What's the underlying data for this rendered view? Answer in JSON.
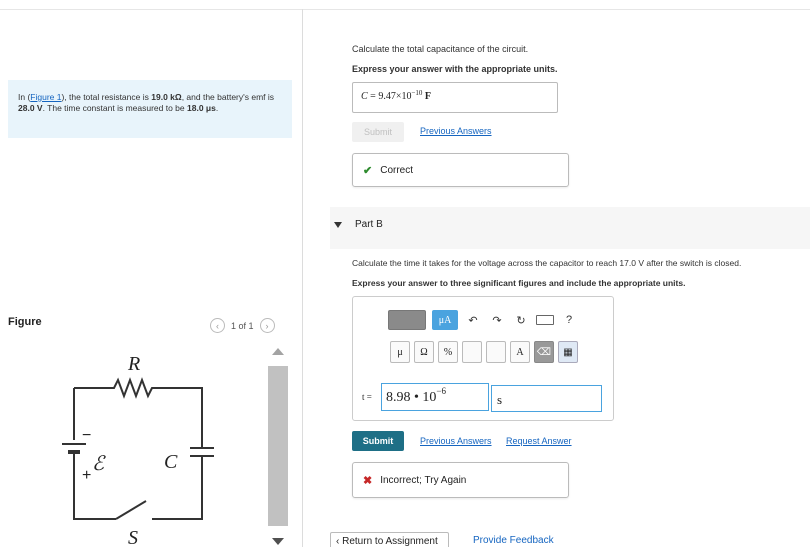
{
  "intro": {
    "prefix": "In (",
    "figure_link": "Figure 1",
    "text1": "), the total resistance is",
    "resistance": "19.0 kΩ",
    "text2": ", and the battery's emf is",
    "emf": "28.0 V",
    "text3": ". The time constant is measured to be",
    "time_constant": "18.0 μs",
    "text4": "."
  },
  "figure": {
    "title": "Figure",
    "pager": "1 of 1",
    "labels": {
      "R": "R",
      "emf": "ℰ",
      "C": "C",
      "S": "S",
      "plus": "+",
      "minus": "−"
    }
  },
  "partA": {
    "question": "Calculate the total capacitance of the circuit.",
    "instruction": "Express your answer with the appropriate units.",
    "answer_var": "C",
    "answer_mantissa": "9.47×10",
    "answer_exp": "−10",
    "answer_unit": "F",
    "submit_label": "Submit",
    "previous_answers": "Previous Answers",
    "feedback": "Correct"
  },
  "partB": {
    "label": "Part B",
    "question": "Calculate the time it takes for the voltage across the capacitor to reach 17.0 V after the switch is closed.",
    "instruction": "Express your answer to three significant figures and include the appropriate units.",
    "toolbar": {
      "mu_btn": "μA",
      "help": "?",
      "mu": "μ",
      "omega": "Ω",
      "percent": "%",
      "angstrom": "A"
    },
    "var_label": "t =",
    "value_mantissa": "8.98 • 10",
    "value_exp": "−6",
    "unit": "s",
    "submit_label": "Submit",
    "previous_answers": "Previous Answers",
    "request_answer": "Request Answer",
    "feedback": "Incorrect; Try Again"
  },
  "footer": {
    "return_label": "Return to Assignment",
    "provide_feedback": "Provide Feedback"
  },
  "colors": {
    "accent": "#1e6f86",
    "link": "#1565c0",
    "correct": "#2e8b2e",
    "incorrect": "#c62828",
    "intro_bg": "#e8f4fb"
  }
}
